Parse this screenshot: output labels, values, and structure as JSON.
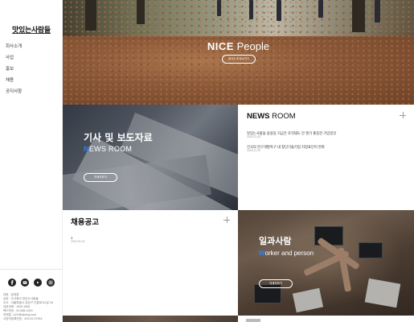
{
  "logo": "맛있는사람들",
  "nav": [
    {
      "label": "회사소개"
    },
    {
      "label": "사업"
    },
    {
      "label": "홍보"
    },
    {
      "label": "채용"
    },
    {
      "label": "공지사항"
    }
  ],
  "sns_icons": [
    "facebook-icon",
    "blog-icon",
    "youtube-icon",
    "instagram-icon"
  ],
  "footer": [
    "대표 : 유정훈",
    "상호 : 주식회사 맛있는사람들",
    "주소 : 서울특별시 강남구 선릉로111길 34",
    "대표전화 : 1833-1846",
    "팩스번호 : 02-568-4324",
    "이메일 : y21@nfpeng.com",
    "사업자등록번호 : 220-81-97944"
  ],
  "hero": {
    "title_bold": "NICE",
    "title_light": " People",
    "button": "회사소개 바로가기"
  },
  "news_panel": {
    "title_kr": "기사 및 보도자료",
    "title_en_accent": "N",
    "title_en_rest": "EWS ROOM",
    "button": "자세히보기"
  },
  "newsroom": {
    "title_bold": "NEWS",
    "title_light": " ROOM",
    "items": [
      {
        "title": "맛있는사람들 용용동 지금은 조약돼도 안 엔가 좋동한 가임일것",
        "date": "2018-11-30"
      },
      {
        "title": "건국의 연구개발특구 내 창단기술기업 지정표인이 완화",
        "date": "2018-11-20"
      }
    ]
  },
  "recruit": {
    "title": "채용공고",
    "items": [
      {
        "title": "1",
        "date": "2019-03-04"
      }
    ]
  },
  "work_panel": {
    "title_kr": "일과사람",
    "title_en_accent": "W",
    "title_en_rest": "orker and person",
    "button": "자세히보기"
  },
  "colors": {
    "accent": "#2f80ed"
  }
}
